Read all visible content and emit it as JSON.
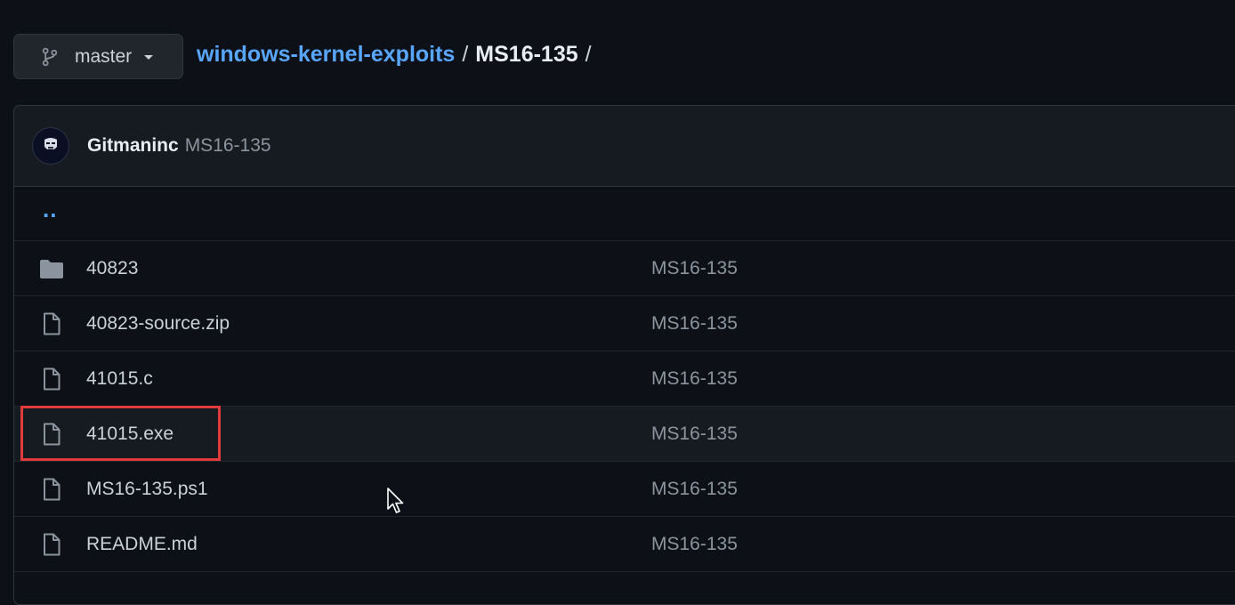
{
  "branch": {
    "name": "master",
    "icon": "git-branch-icon"
  },
  "breadcrumb": {
    "repo": "windows-kernel-exploits",
    "separator": "/",
    "current": "MS16-135",
    "trailing": "/"
  },
  "commit_header": {
    "author": "Gitmaninc",
    "message": "MS16-135"
  },
  "parent_link": "..",
  "files": [
    {
      "name": "40823",
      "type": "folder",
      "commit": "MS16-135"
    },
    {
      "name": "40823-source.zip",
      "type": "file",
      "commit": "MS16-135"
    },
    {
      "name": "41015.c",
      "type": "file",
      "commit": "MS16-135"
    },
    {
      "name": "41015.exe",
      "type": "file",
      "commit": "MS16-135"
    },
    {
      "name": "MS16-135.ps1",
      "type": "file",
      "commit": "MS16-135"
    },
    {
      "name": "README.md",
      "type": "file",
      "commit": "MS16-135"
    }
  ],
  "colors": {
    "background": "#0d1117",
    "link": "#58a6ff",
    "highlight_box": "#e03a3a"
  }
}
